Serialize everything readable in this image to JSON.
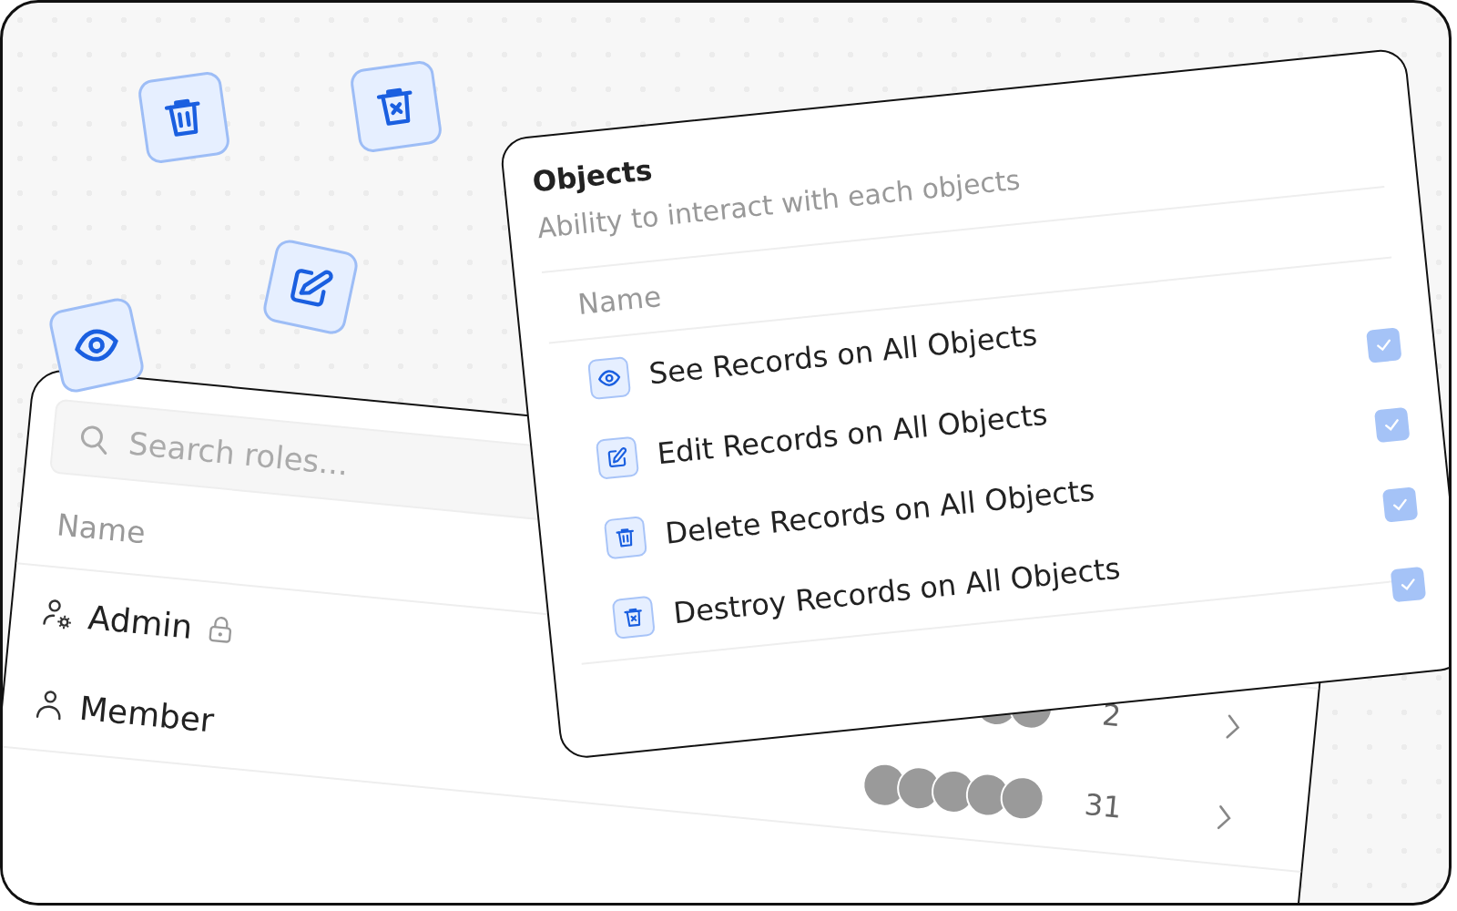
{
  "floating_icons": [
    {
      "kind": "trash"
    },
    {
      "kind": "trash-x"
    },
    {
      "kind": "edit"
    },
    {
      "kind": "eye"
    }
  ],
  "roles": {
    "search": {
      "placeholder": "Search roles..."
    },
    "columns": [
      "Name"
    ],
    "rows": [
      {
        "name": "Admin",
        "kind": "admin",
        "locked": true,
        "avatars": [
          {
            "kind": "photo"
          },
          {
            "kind": "photo"
          }
        ],
        "count": "2"
      },
      {
        "name": "Member",
        "kind": "member",
        "locked": false,
        "avatars": [
          {
            "kind": "photo"
          },
          {
            "kind": "photo"
          },
          {
            "kind": "photo"
          },
          {
            "kind": "photo"
          },
          {
            "kind": "photo"
          }
        ],
        "count": "31"
      }
    ]
  },
  "objects": {
    "title": "Objects",
    "subtitle": "Ability to interact with each objects",
    "column": "Name",
    "rows": [
      {
        "label": "See Records on All Objects",
        "kind": "eye",
        "checked": true
      },
      {
        "label": "Edit Records on All Objects",
        "kind": "edit",
        "checked": true
      },
      {
        "label": "Delete Records on All Objects",
        "kind": "trash",
        "checked": true
      },
      {
        "label": "Destroy Records on All Objects",
        "kind": "trash-x",
        "checked": true
      }
    ]
  }
}
